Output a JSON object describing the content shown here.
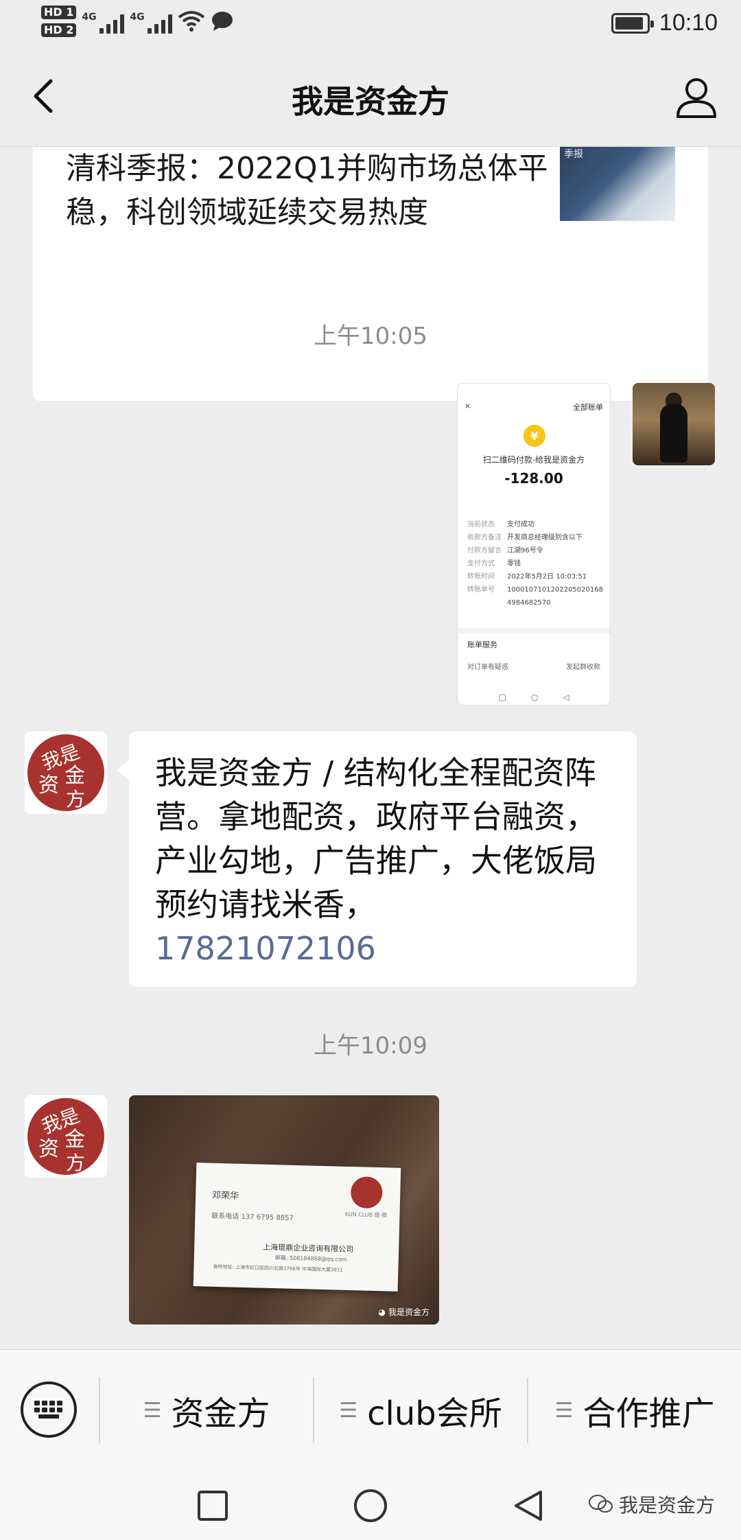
{
  "status_bar": {
    "hd1": "HD 1",
    "hd2": "HD 2",
    "net1": "4G",
    "net2": "4G",
    "time": "10:10",
    "icons": [
      "signal-icon",
      "wifi-icon",
      "message-icon",
      "battery-icon"
    ],
    "battery_level": 0.9
  },
  "nav": {
    "title": "我是资金方",
    "back_icon": "chevron-left-icon",
    "profile_icon": "person-icon"
  },
  "chat": {
    "article": {
      "title": "清科季报：2022Q1并购市场总体平稳，科创领域延续交易热度",
      "thumb_text": "季报"
    },
    "timestamp1": "上午10:05",
    "receipt": {
      "header_left": "×",
      "header_right": "全部账单",
      "merchant": "扫二维码付款-给我是资金方",
      "amount": "-128.00",
      "rows": [
        {
          "k": "当前状态",
          "v": "支付成功"
        },
        {
          "k": "收款方备注",
          "v": "开发商总经理级别含以下"
        },
        {
          "k": "付款方留言",
          "v": "江湖96号令"
        },
        {
          "k": "支付方式",
          "v": "零钱"
        },
        {
          "k": "转账时间",
          "v": "2022年5月2日 10:03:51"
        },
        {
          "k": "转账单号",
          "v": "1000107101202205020168498468257​0"
        }
      ],
      "service_label": "账单服务",
      "link1": "对订单有疑惑",
      "link2": "发起群收款"
    },
    "text_message": "我是资金方 / 结构化全程配资阵营。拿地配资，政府平台融资，产业勾地，广告推广，大佬饭局预约请找米香，",
    "phone": "17821072106",
    "timestamp2": "上午10:09",
    "business_card": {
      "name": "邓荣华",
      "phone_line": "联系电话  137 6795 8857",
      "company": "上海琨鼎企业咨询有限公司",
      "email": "邮箱: 508184868@qq.com",
      "address": "会所地址: 上海市虹口区四川北路1766号 中海国际大厦3811",
      "club": "KUN CLUB 琨·鼎",
      "watermark": "我是资金方"
    }
  },
  "menu": {
    "keyboard_icon": "keyboard-icon",
    "items": [
      {
        "label": "资金方"
      },
      {
        "label": "club会所"
      },
      {
        "label": "合作推广"
      }
    ]
  },
  "system_nav": {
    "icons": [
      "square-icon",
      "circle-icon",
      "triangle-back-icon"
    ],
    "watermark": "我是资金方"
  },
  "colors": {
    "background": "#ededed",
    "link": "#576b95",
    "seal_red": "#a8322d"
  }
}
